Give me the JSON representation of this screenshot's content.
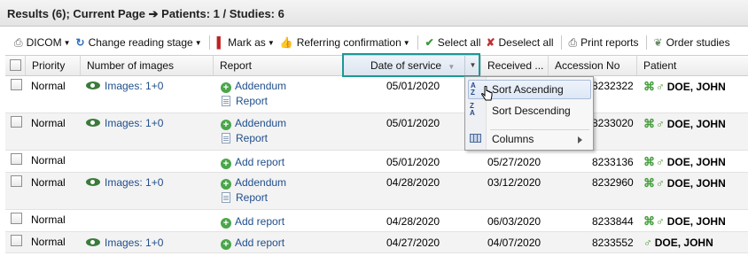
{
  "title": "Results (6); Current Page ➔ Patients: 1 / Studies: 6",
  "toolbar": {
    "dicom": "DICOM",
    "change_stage": "Change reading stage",
    "mark_as": "Mark as",
    "referring": "Referring confirmation",
    "select_all": "Select all",
    "deselect_all": "Deselect all",
    "print_reports": "Print reports",
    "order_studies": "Order studies"
  },
  "columns": {
    "priority": "Priority",
    "images": "Number of images",
    "report": "Report",
    "date_service": "Date of service",
    "received": "Received ...",
    "accession": "Accession No",
    "patient": "Patient"
  },
  "rows": [
    {
      "priority": "Normal",
      "images": "Images: 1+0",
      "report1": "Addendum",
      "report2": "Report",
      "date": "05/01/2020",
      "received": "",
      "accession": "8232322",
      "patient": "DOE, JOHN"
    },
    {
      "priority": "Normal",
      "images": "Images: 1+0",
      "report1": "Addendum",
      "report2": "Report",
      "date": "05/01/2020",
      "received": "",
      "accession": "8233020",
      "patient": "DOE, JOHN"
    },
    {
      "priority": "Normal",
      "images": "",
      "report1": "Add report",
      "report2": "",
      "date": "05/01/2020",
      "received": "05/27/2020",
      "accession": "8233136",
      "patient": "DOE, JOHN"
    },
    {
      "priority": "Normal",
      "images": "Images: 1+0",
      "report1": "Addendum",
      "report2": "Report",
      "date": "04/28/2020",
      "received": "03/12/2020",
      "accession": "8232960",
      "patient": "DOE, JOHN"
    },
    {
      "priority": "Normal",
      "images": "",
      "report1": "Add report",
      "report2": "",
      "date": "04/28/2020",
      "received": "06/03/2020",
      "accession": "8233844",
      "patient": "DOE, JOHN"
    },
    {
      "priority": "Normal",
      "images": "Images: 1+0",
      "report1": "Add report",
      "report2": "",
      "date": "04/27/2020",
      "received": "04/07/2020",
      "accession": "8233552",
      "patient": "DOE, JOHN"
    }
  ],
  "context_menu": {
    "sort_asc": "Sort Ascending",
    "sort_desc": "Sort Descending",
    "columns": "Columns"
  }
}
